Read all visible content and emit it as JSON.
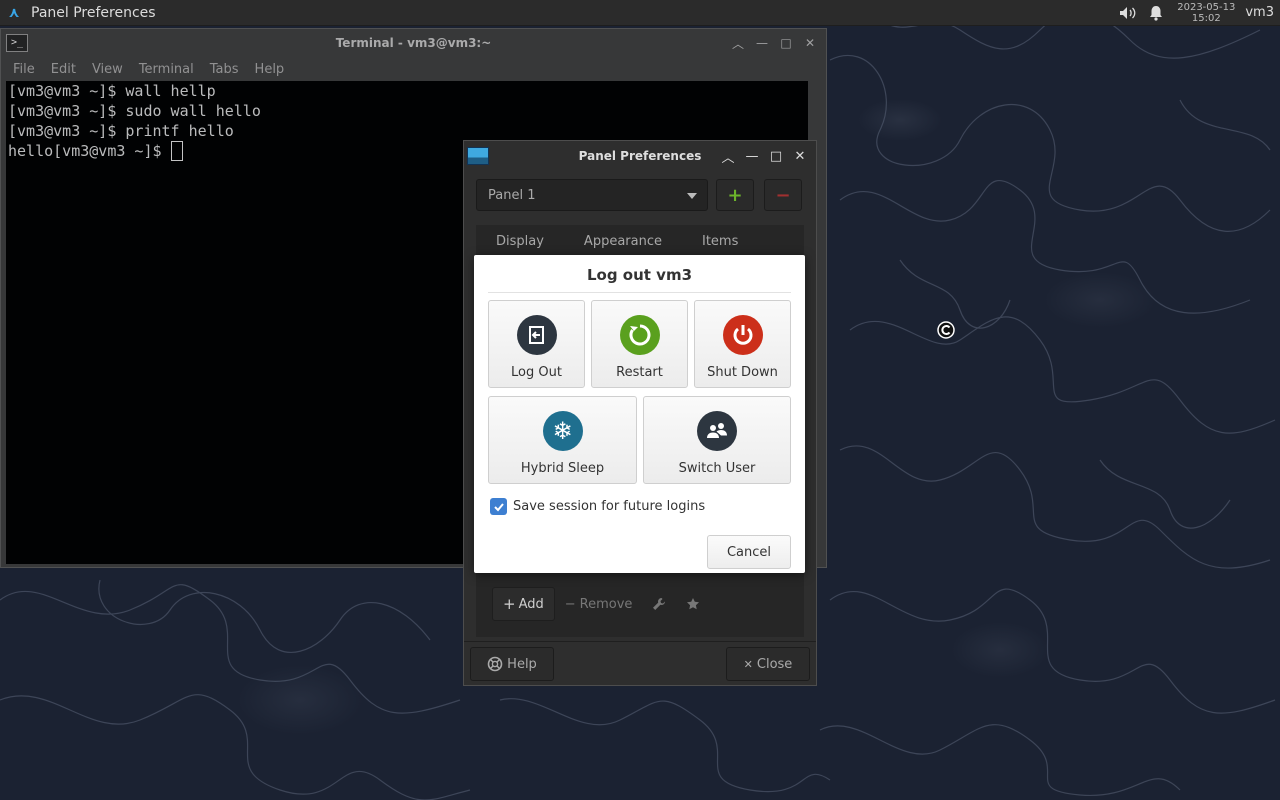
{
  "top_panel": {
    "active_window_title": "Panel Preferences",
    "clock_date": "2023-05-13",
    "clock_time": "15:02",
    "user": "vm3",
    "tray_icons": [
      "volume-icon",
      "notification-bell-icon"
    ]
  },
  "terminal": {
    "title": "Terminal - vm3@vm3:~",
    "menu": [
      "File",
      "Edit",
      "View",
      "Terminal",
      "Tabs",
      "Help"
    ],
    "lines": [
      "[vm3@vm3 ~]$ wall hellp",
      "[vm3@vm3 ~]$ sudo wall hello",
      "[vm3@vm3 ~]$ printf hello",
      "hello[vm3@vm3 ~]$ "
    ]
  },
  "prefs": {
    "title": "Panel Preferences",
    "panel_selected": "Panel 1",
    "add_panel_symbol": "+",
    "remove_panel_symbol": "−",
    "tabs": [
      "Display",
      "Appearance",
      "Items"
    ],
    "toolbar": {
      "add_label": "Add",
      "remove_label": "Remove"
    },
    "help_label": "Help",
    "close_label": "Close"
  },
  "logout": {
    "title": "Log out vm3",
    "actions": {
      "logout": "Log Out",
      "restart": "Restart",
      "shutdown": "Shut Down",
      "hybrid_sleep": "Hybrid Sleep",
      "switch_user": "Switch User"
    },
    "save_session_label": "Save session for future logins",
    "save_session_checked": true,
    "cancel_label": "Cancel"
  },
  "colors": {
    "logout_icon": "#2d3640",
    "restart_icon": "#5aa01e",
    "shutdown_icon": "#cc2f1a",
    "hybrid_sleep_icon": "#1f6f8f",
    "switch_user_icon": "#2d3640",
    "checkbox_accent": "#3d7fd1",
    "add_green": "#6cb42b",
    "remove_red": "#a03030"
  }
}
